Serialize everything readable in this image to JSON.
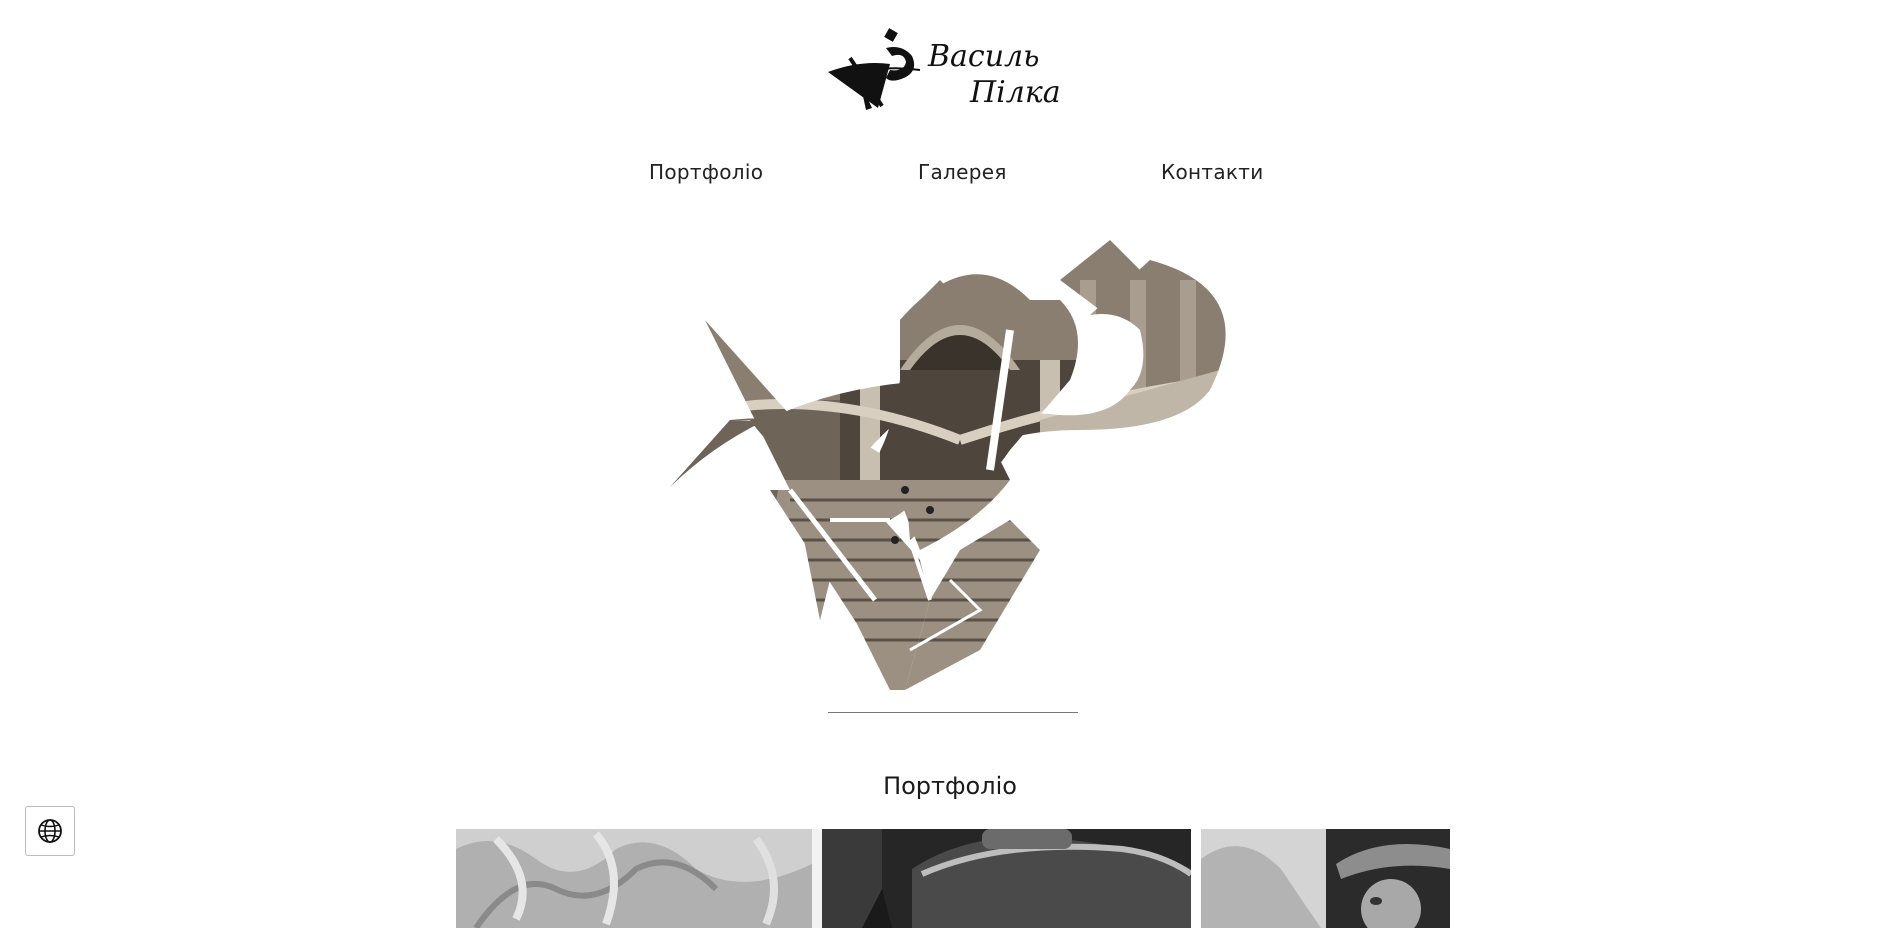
{
  "header": {
    "logo_signature_line1": "Василь",
    "logo_signature_line2": "Пілка"
  },
  "nav": {
    "items": [
      {
        "label": "Портфоліо"
      },
      {
        "label": "Галерея"
      },
      {
        "label": "Контакти"
      }
    ]
  },
  "portfolio": {
    "title": "Портфоліо"
  },
  "language_button": {
    "icon": "globe-icon"
  }
}
